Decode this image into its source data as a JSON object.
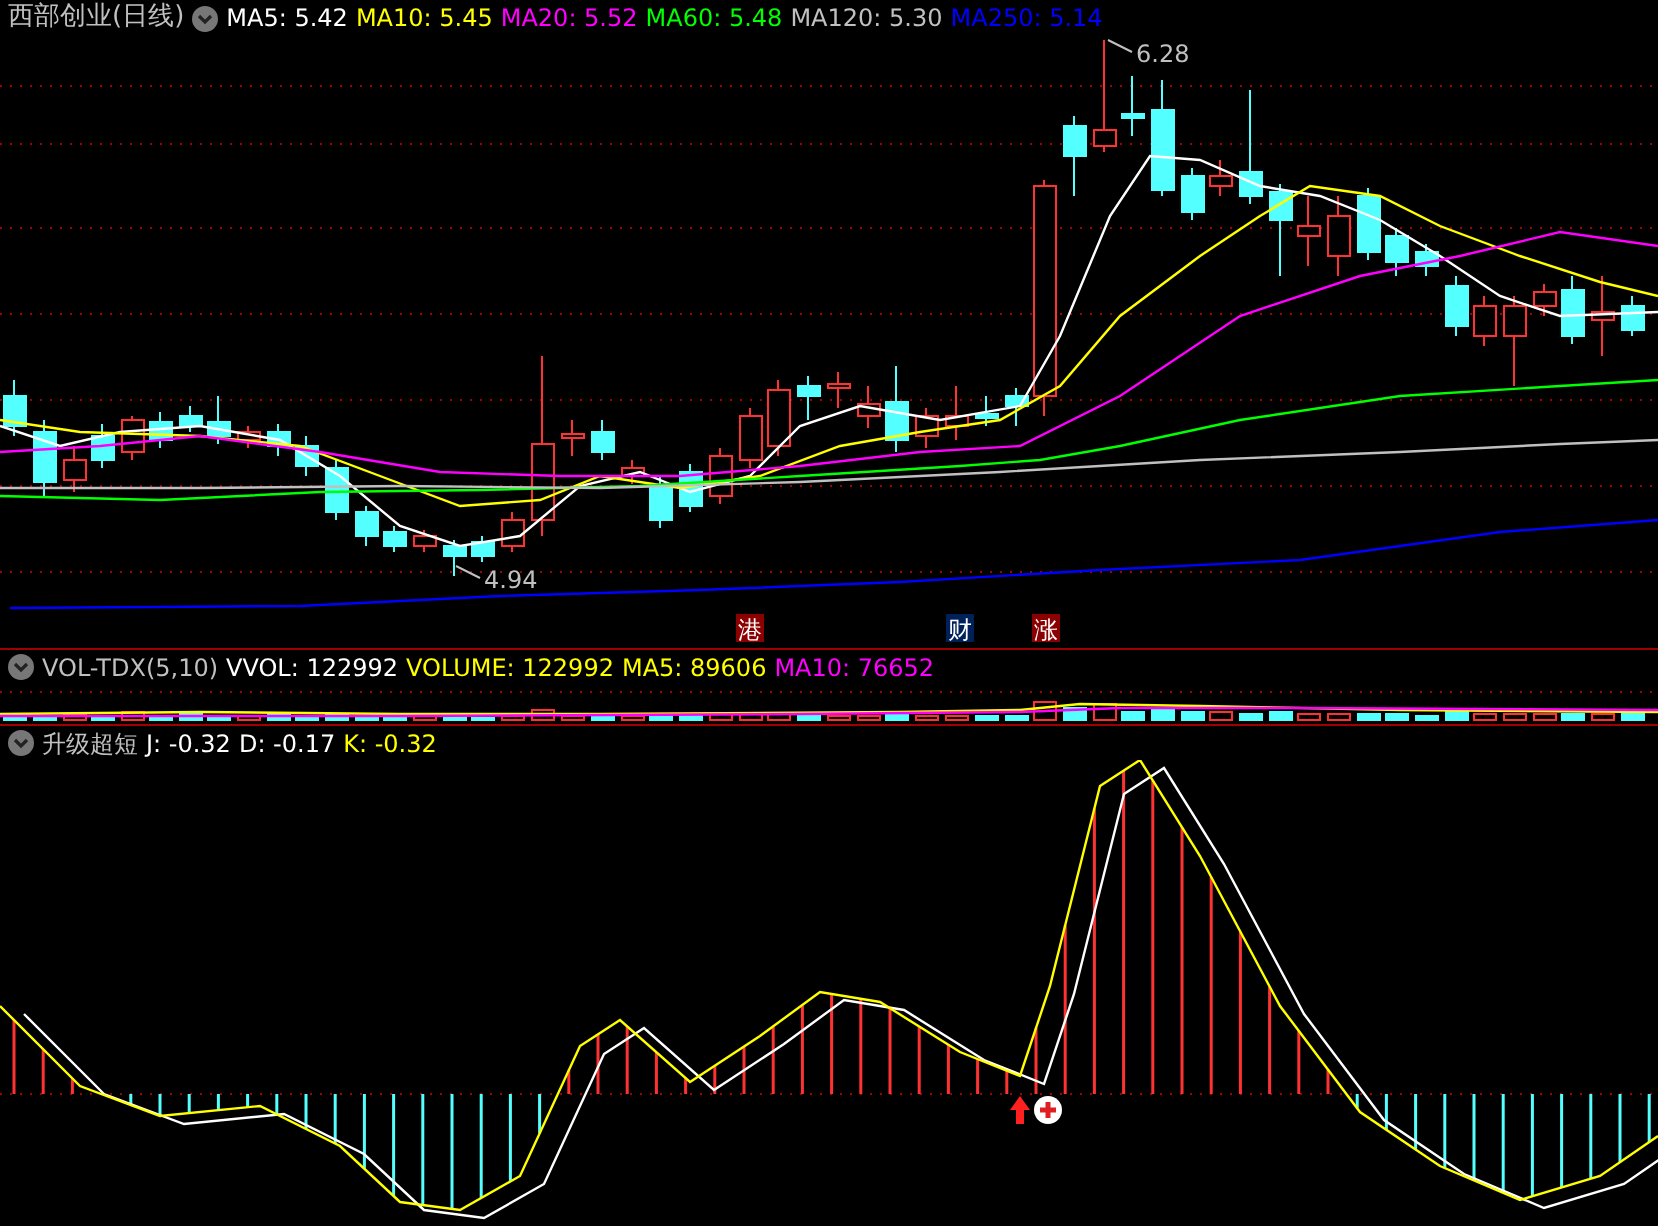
{
  "title": "西部创业(日线)",
  "ma_legend": [
    {
      "label": "MA5: 5.42",
      "color": "#ffffff"
    },
    {
      "label": "MA10: 5.45",
      "color": "#ffff00"
    },
    {
      "label": "MA20: 5.52",
      "color": "#ff00ff"
    },
    {
      "label": "MA60: 5.48",
      "color": "#00ff00"
    },
    {
      "label": "MA120: 5.30",
      "color": "#c0c0c0"
    },
    {
      "label": "MA250: 5.14",
      "color": "#0000ff"
    }
  ],
  "price_labels": [
    {
      "kind": "high",
      "text": "6.28"
    },
    {
      "kind": "low",
      "text": "4.94"
    }
  ],
  "markers": [
    {
      "text": "港",
      "color": "#8b0000"
    },
    {
      "text": "财",
      "color": "#00205a"
    },
    {
      "text": "涨",
      "color": "#8b0000"
    }
  ],
  "volume_legend": {
    "name": "VOL-TDX(5,10)",
    "items": [
      {
        "label": "VVOL: 122992",
        "color": "#ffffff"
      },
      {
        "label": "VOLUME: 122992",
        "color": "#ffff00"
      },
      {
        "label": "MA5: 89606",
        "color": "#ffff00"
      },
      {
        "label": "MA10: 76652",
        "color": "#ff00ff"
      }
    ]
  },
  "indicator_legend": {
    "name": "升级超短",
    "items": [
      {
        "label": "J: -0.32",
        "color": "#ffffff"
      },
      {
        "label": "D: -0.17",
        "color": "#ffffff"
      },
      {
        "label": "K: -0.32",
        "color": "#ffff00"
      }
    ]
  }
}
